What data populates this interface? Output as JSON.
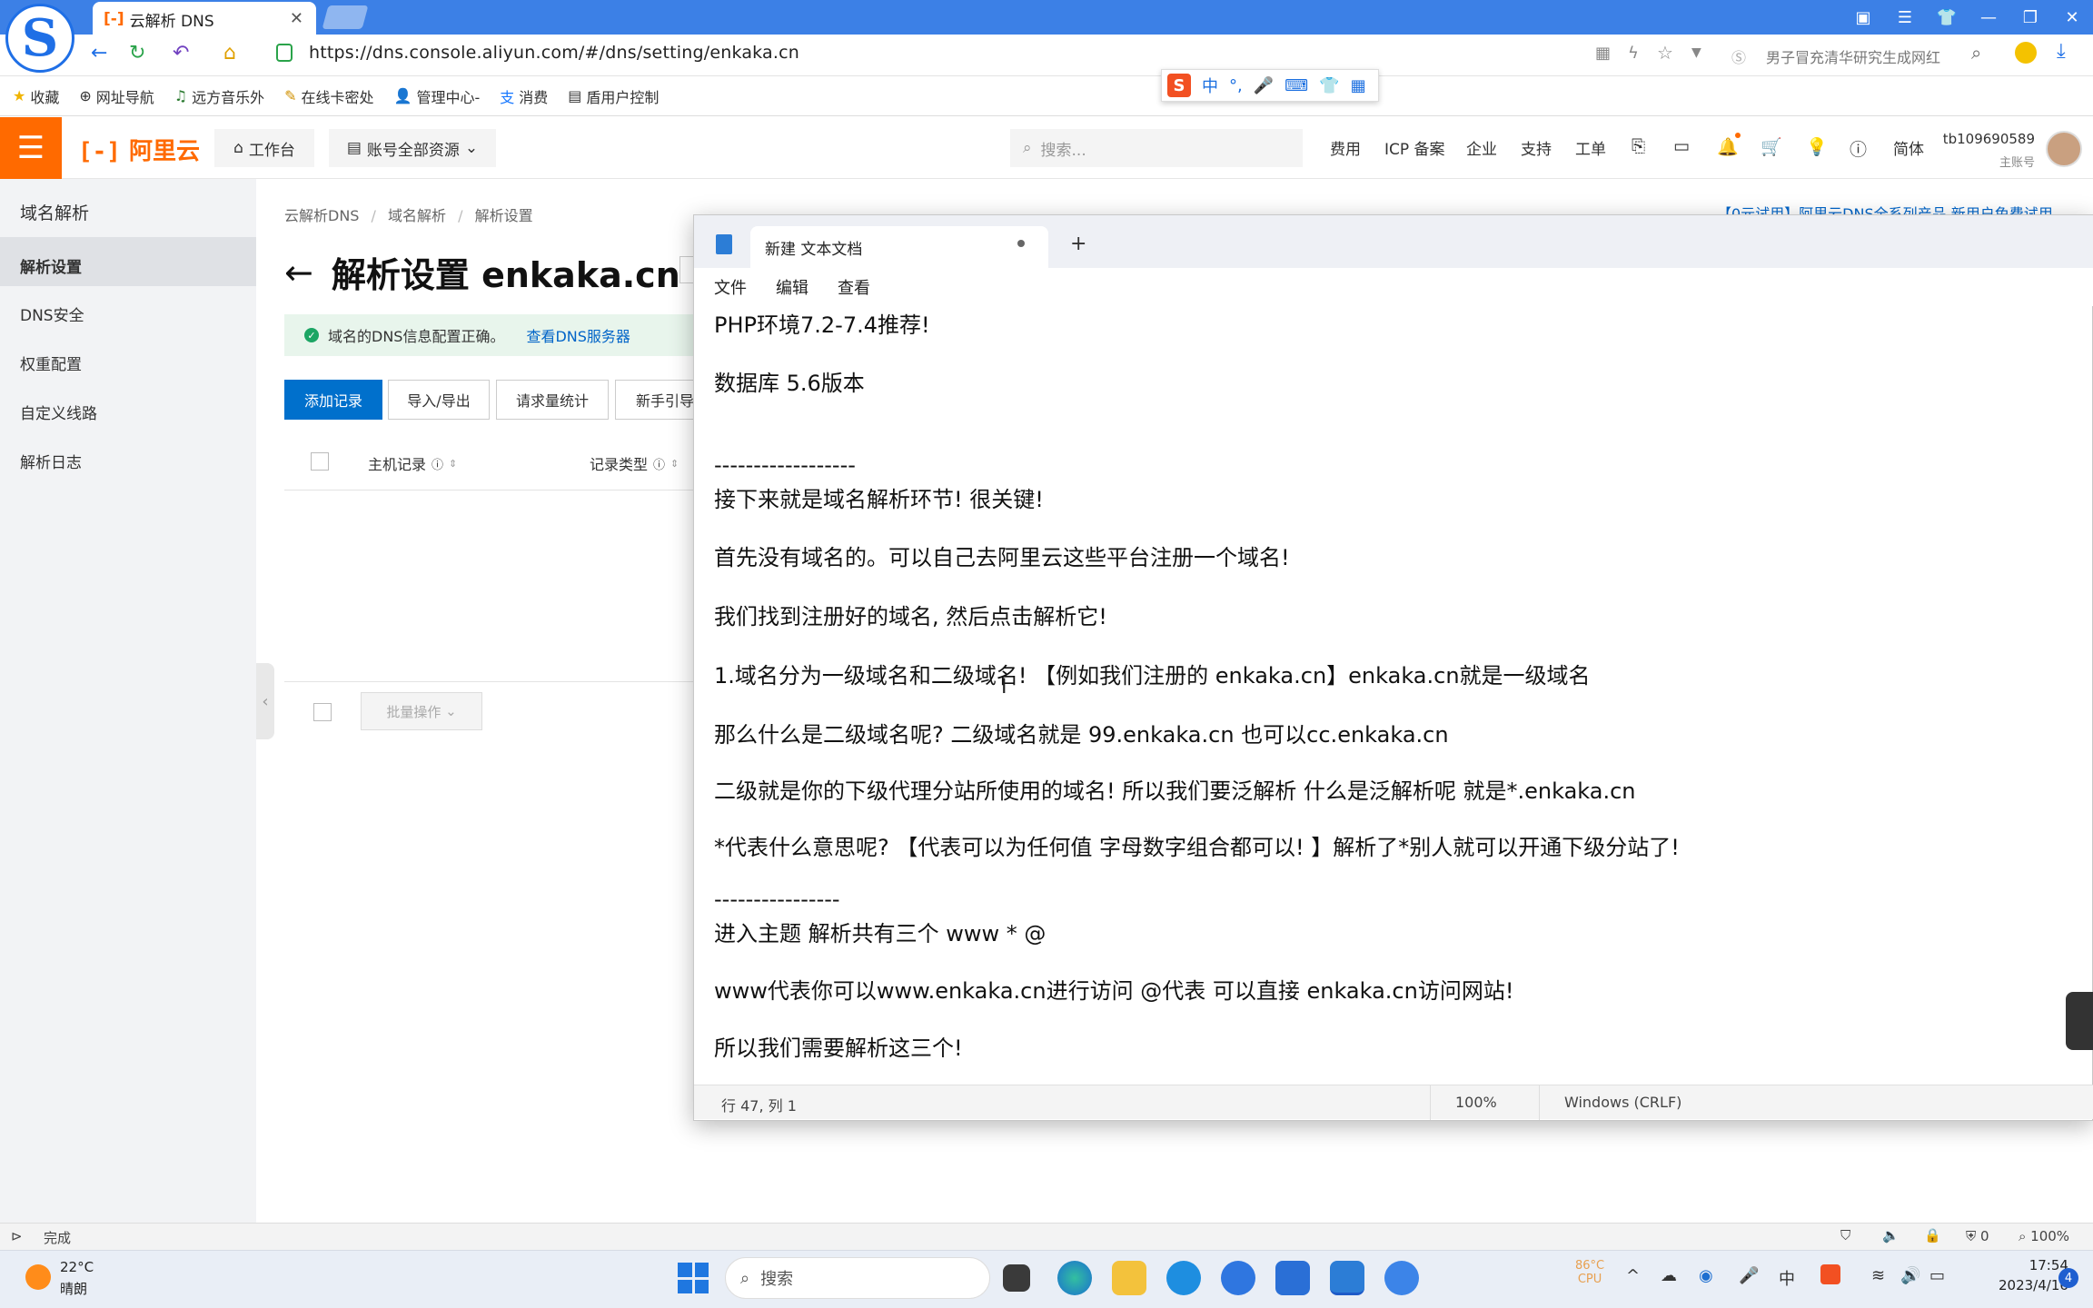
{
  "browser": {
    "tab_title": "云解析 DNS",
    "url": "https://dns.console.aliyun.com/#/dns/setting/enkaka.cn",
    "search_hint": "男子冒充清华研究生成网红",
    "status": "完成",
    "zoom": "100%",
    "shield_count": "0"
  },
  "bookmarks": [
    "收藏",
    "网址导航",
    "远方音乐外",
    "在线卡密处",
    "管理中心-",
    "消费",
    "盾用户控制"
  ],
  "ime": {
    "lang": "中"
  },
  "header": {
    "logo": "阿里云",
    "workbench": "工作台",
    "resources": "账号全部资源",
    "search_placeholder": "搜索...",
    "nav": [
      "费用",
      "ICP 备案",
      "企业",
      "支持",
      "工单"
    ],
    "lang": "简体",
    "account": "tb109690589",
    "account_sub": "主账号"
  },
  "sidebar": {
    "title": "域名解析",
    "items": [
      "解析设置",
      "DNS安全",
      "权重配置",
      "自定义线路",
      "解析日志"
    ]
  },
  "main": {
    "breadcrumb": [
      "云解析DNS",
      "域名解析",
      "解析设置"
    ],
    "title": "解析设置 enkaka.cn",
    "notice": "域名的DNS信息配置正确。",
    "notice_link": "查看DNS服务器",
    "buttons": [
      "添加记录",
      "导入/导出",
      "请求量统计",
      "新手引导"
    ],
    "col_host": "主机记录",
    "col_type": "记录类型",
    "batch": "批量操作",
    "promo": "【0元试用】阿里云DNS全系列产品 新用户免费试用"
  },
  "notepad": {
    "tab_title": "新建 文本文档",
    "menu": [
      "文件",
      "编辑",
      "查看"
    ],
    "lines": [
      "PHP环境7.2-7.4推荐!",
      "数据库 5.6版本",
      "------------------",
      "接下来就是域名解析环节! 很关键!",
      "首先没有域名的。可以自己去阿里云这些平台注册一个域名!",
      "我们找到注册好的域名, 然后点击解析它!",
      "1.域名分为一级域名和二级域名! 【例如我们注册的 enkaka.cn】enkaka.cn就是一级域名",
      "那么什么是二级域名呢? 二级域名就是 99.enkaka.cn 也可以cc.enkaka.cn",
      "二级就是你的下级代理分站所使用的域名! 所以我们要泛解析 什么是泛解析呢 就是*.enkaka.cn",
      "*代表什么意思呢? 【代表可以为任何值 字母数字组合都可以! 】解析了*别人就可以开通下级分站了!",
      "----------------",
      "进入主题 解析共有三个 www * @",
      "www代表你可以www.enkaka.cn进行访问 @代表 可以直接 enkaka.cn访问网站!",
      "所以我们需要解析这三个!"
    ],
    "status_pos": "行 47, 列 1",
    "status_zoom": "100%",
    "status_eol": "Windows (CRLF)"
  },
  "taskbar": {
    "temp": "22°C",
    "weather": "晴朗",
    "search": "搜索",
    "cpu_temp": "86°C",
    "cpu_label": "CPU",
    "ime": "中",
    "time": "17:54",
    "date": "2023/4/16",
    "badge": "4"
  }
}
